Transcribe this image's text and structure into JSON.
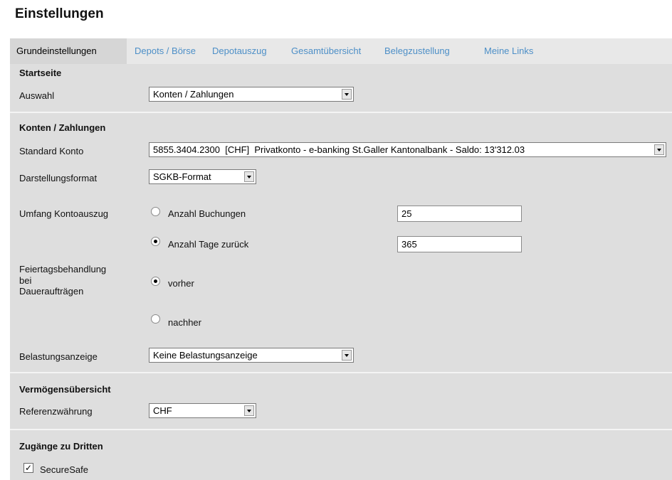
{
  "page": {
    "title": "Einstellungen"
  },
  "tabs": [
    {
      "label": "Grundeinstellungen",
      "active": true
    },
    {
      "label": "Depots / Börse",
      "active": false
    },
    {
      "label": "Depotauszug",
      "active": false
    },
    {
      "label": "Gesamtübersicht",
      "active": false
    },
    {
      "label": "Belegzustellung",
      "active": false
    },
    {
      "label": "Meine Links",
      "active": false
    }
  ],
  "startseite": {
    "title": "Startseite",
    "auswahl_label": "Auswahl",
    "auswahl_value": "Konten / Zahlungen"
  },
  "konten": {
    "title": "Konten / Zahlungen",
    "standard_konto_label": "Standard Konto",
    "standard_konto_value": "5855.3404.2300  [CHF]  Privatkonto - e-banking St.Galler Kantonalbank - Saldo: 13'312.03",
    "darstellungsformat_label": "Darstellungsformat",
    "darstellungsformat_value": "SGKB-Format",
    "umfang_label": "Umfang Kontoauszug",
    "radio_buchungen_label": "Anzahl Buchungen",
    "radio_buchungen_value": "25",
    "radio_tage_label": "Anzahl Tage zurück",
    "radio_tage_value": "365",
    "feiertag_label_1": "Feiertagsbehandlung",
    "feiertag_label_2": "bei",
    "feiertag_label_3": "Daueraufträgen",
    "radio_vorher_label": "vorher",
    "radio_nachher_label": "nachher",
    "belastung_label": "Belastungsanzeige",
    "belastung_value": "Keine Belastungsanzeige"
  },
  "vermoegen": {
    "title": "Vermögensübersicht",
    "referenz_label": "Referenzwährung",
    "referenz_value": "CHF"
  },
  "dritte": {
    "title": "Zugänge zu Dritten",
    "securesafe_label": "SecureSafe",
    "securesafe_checked": true
  },
  "colors": {
    "tab_link": "#4d8fc7",
    "panel_bg": "#dedede",
    "tabbar_bg": "#e8e8e8"
  }
}
